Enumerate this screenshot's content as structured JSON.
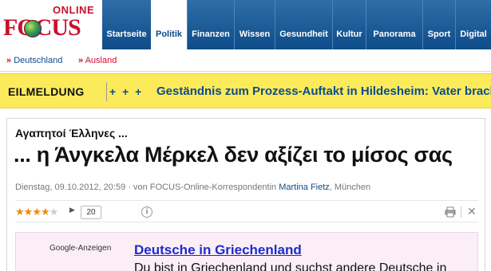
{
  "logo": {
    "online": "ONLINE",
    "focus": "FOCUS"
  },
  "nav": {
    "items": [
      {
        "label": "Startseite",
        "active": false
      },
      {
        "label": "Politik",
        "active": true
      },
      {
        "label": "Finanzen",
        "active": false
      },
      {
        "label": "Wissen",
        "active": false
      },
      {
        "label": "Gesundheit",
        "active": false
      },
      {
        "label": "Kultur",
        "active": false
      },
      {
        "label": "Panorama",
        "active": false
      },
      {
        "label": "Sport",
        "active": false
      },
      {
        "label": "Digital",
        "active": false
      }
    ]
  },
  "breadcrumb": {
    "arrow": "»",
    "items": [
      "Deutschland",
      "Ausland"
    ]
  },
  "breaking": {
    "label": "EILMELDUNG",
    "plus": "+ + +",
    "text": "Geständnis zum Prozess-Auftakt in Hildesheim: Vater bracht"
  },
  "article": {
    "kicker": "Αγαπητοί Έλληνες ...",
    "headline": "... η Άνγκελα Μέρκελ δεν αξίζει το μίσος σας",
    "meta_prefix": "Dienstag, 09.10.2012, 20:59 · von FOCUS-Online-Korrespondentin ",
    "author": "Martina Fietz",
    "meta_suffix": ", München",
    "rating": {
      "stars_filled": 4,
      "stars_total": 5,
      "comment_count": "20"
    },
    "info_glyph": "i",
    "close_glyph": "✕"
  },
  "ad": {
    "label": "Google-Anzeigen",
    "title": "Deutsche in Griechenland",
    "text": "Du bist in Griechenland und suchst andere Deutsche in"
  },
  "colors": {
    "brand_red": "#c8102e",
    "nav_blue": "#0e4c8a",
    "breaking_yellow": "#fbeb5b",
    "ad_link": "#1d2bd1"
  }
}
